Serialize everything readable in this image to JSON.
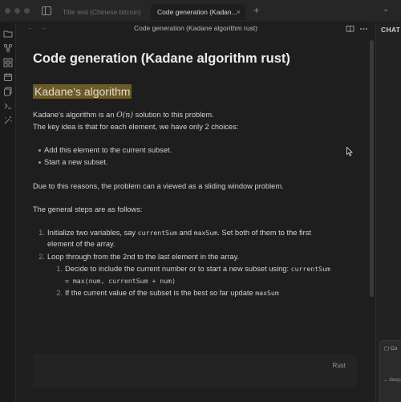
{
  "tabs": [
    {
      "label": "Title test (Chinese bitcoin)",
      "active": false
    },
    {
      "label": "Code generation (Kadan...",
      "active": true
    }
  ],
  "tabbar": {
    "close_glyph": "×",
    "new_tab_glyph": "+",
    "chevron_glyph": "⌄"
  },
  "view": {
    "title": "Code generation (Kadane algorithm rust)",
    "back_glyph": "←",
    "forward_glyph": "→"
  },
  "document": {
    "h1": "Code generation (Kadane algorithm rust)",
    "h2": "Kadane's algorithm",
    "intro_prefix": "Kadane's algorithm is an ",
    "intro_math": "O(n)",
    "intro_suffix": " solution to this problem.",
    "intro_line2": "The key idea is that for each element, we have only 2 choices:",
    "choices": [
      "Add this element to the current subset.",
      "Start a new subset."
    ],
    "para_window": "Due to this reasons, the problem can a viewed as a sliding window problem.",
    "para_steps": "The general steps are as follows:",
    "steps": {
      "s1_num": "1.",
      "s1_a": "Initialize two variables, say ",
      "s1_code1": "currentSum",
      "s1_b": " and ",
      "s1_code2": "maxSum",
      "s1_c": ". Set both of them to the first",
      "s1_line2": "element of the array.",
      "s2_num": "2.",
      "s2": "Loop through from the 2nd to the last element in the array.",
      "s2_1_num": "1.",
      "s2_1_a": "Decide to include the current number or to start a new subset using: ",
      "s2_1_code": "currentSum",
      "s2_1_line2_code": "= max(num, currentSum + num)",
      "s2_2_num": "2.",
      "s2_2_a": "If the current value of the subset is the best so far update ",
      "s2_2_code": "maxSum"
    },
    "codeblock_lang": "Rust"
  },
  "right_panel": {
    "title": "CHAT",
    "chip": "Co",
    "model": "deep"
  },
  "icons": {
    "ribbon": [
      "folder-icon",
      "graph-icon",
      "grid-icon",
      "calendar-icon",
      "copy-icon",
      "terminal-icon",
      "magic-icon"
    ],
    "view_actions": [
      "book-icon",
      "more-icon"
    ]
  },
  "colors": {
    "background": "#1e1e1e",
    "heading_highlight": "#6b5a2a",
    "text": "#d2d2d2"
  }
}
